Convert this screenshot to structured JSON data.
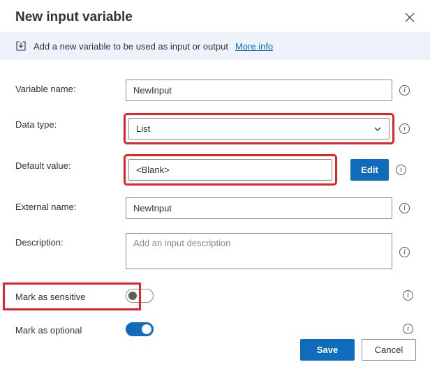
{
  "header": {
    "title": "New input variable"
  },
  "infoBar": {
    "text": "Add a new variable to be used as input or output",
    "linkText": "More info"
  },
  "labels": {
    "variableName": "Variable name:",
    "dataType": "Data type:",
    "defaultValue": "Default value:",
    "externalName": "External name:",
    "description": "Description:",
    "markSensitive": "Mark as sensitive",
    "markOptional": "Mark as optional"
  },
  "values": {
    "variableName": "NewInput",
    "dataType": "List",
    "defaultValue": "<Blank>",
    "externalName": "NewInput",
    "descriptionPlaceholder": "Add an input description"
  },
  "buttons": {
    "edit": "Edit",
    "save": "Save",
    "cancel": "Cancel"
  },
  "toggles": {
    "sensitive": false,
    "optional": true
  }
}
